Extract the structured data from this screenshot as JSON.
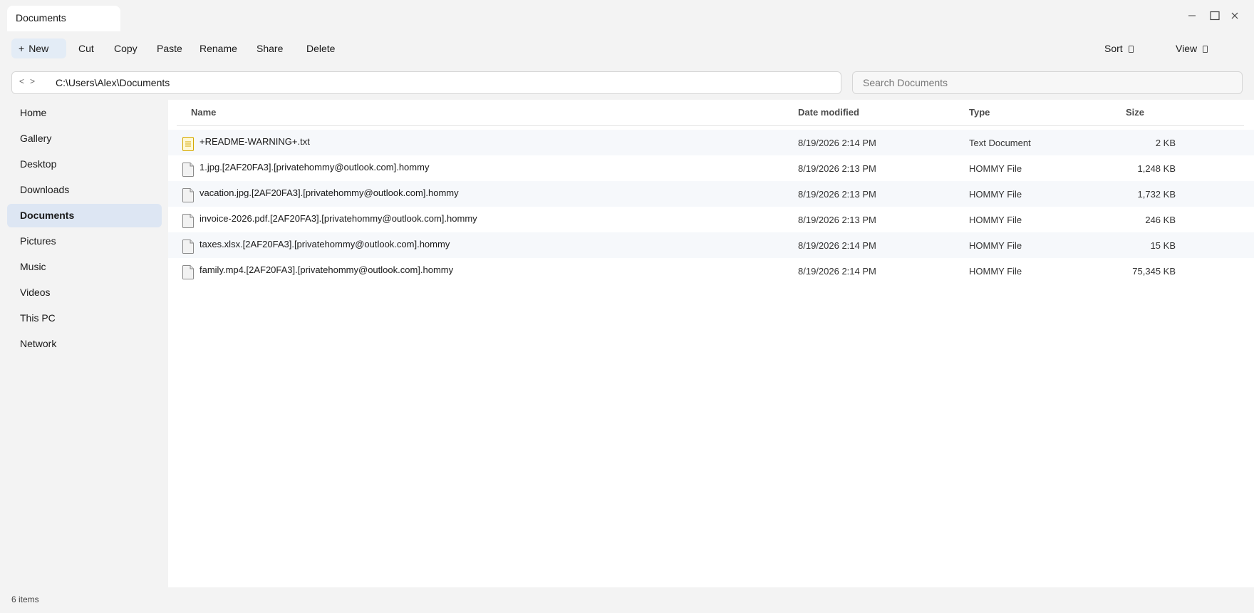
{
  "window": {
    "tab_title": "Documents",
    "controls": [
      "minimize-icon",
      "maximize-icon",
      "close-icon"
    ]
  },
  "toolbar": {
    "new_label": "New",
    "cut_label": "Cut",
    "copy_label": "Copy",
    "paste_label": "Paste",
    "rename_label": "Rename",
    "share_label": "Share",
    "delete_label": "Delete",
    "sort_label": "Sort",
    "view_label": "View"
  },
  "address": {
    "back": "<",
    "forward": ">",
    "path": "C:\\Users\\Alex\\Documents",
    "search_placeholder": "Search Documents"
  },
  "sidebar": {
    "items": [
      {
        "label": "Home"
      },
      {
        "label": "Gallery"
      },
      {
        "label": "Desktop"
      },
      {
        "label": "Downloads"
      },
      {
        "label": "Documents",
        "active": true
      },
      {
        "label": "Pictures"
      },
      {
        "label": "Music"
      },
      {
        "label": "Videos"
      },
      {
        "label": "This PC"
      },
      {
        "label": "Network"
      }
    ]
  },
  "columns": {
    "name": "Name",
    "date": "Date modified",
    "type": "Type",
    "size": "Size"
  },
  "files": [
    {
      "name": "+README-WARNING+.txt",
      "date": "8/19/2026 2:14 PM",
      "type": "Text Document",
      "size": "2 KB",
      "icon": "text-file-icon"
    },
    {
      "name": "1.jpg.[2AF20FA3].[privatehommy@outlook.com].hommy",
      "date": "8/19/2026 2:13 PM",
      "type": "HOMMY File",
      "size": "1,248 KB",
      "icon": "generic-file-icon"
    },
    {
      "name": "vacation.jpg.[2AF20FA3].[privatehommy@outlook.com].hommy",
      "date": "8/19/2026 2:13 PM",
      "type": "HOMMY File",
      "size": "1,732 KB",
      "icon": "generic-file-icon"
    },
    {
      "name": "invoice-2026.pdf.[2AF20FA3].[privatehommy@outlook.com].hommy",
      "date": "8/19/2026 2:13 PM",
      "type": "HOMMY File",
      "size": "246 KB",
      "icon": "generic-file-icon"
    },
    {
      "name": "taxes.xlsx.[2AF20FA3].[privatehommy@outlook.com].hommy",
      "date": "8/19/2026 2:14 PM",
      "type": "HOMMY File",
      "size": "15 KB",
      "icon": "generic-file-icon"
    },
    {
      "name": "family.mp4.[2AF20FA3].[privatehommy@outlook.com].hommy",
      "date": "8/19/2026 2:14 PM",
      "type": "HOMMY File",
      "size": "75,345 KB",
      "icon": "generic-file-icon"
    }
  ],
  "status": {
    "item_count": "6 items"
  },
  "colors": {
    "accent": "#dde6f3",
    "new_button": "#e3ecf6",
    "text_file_icon": "#d4a800"
  }
}
